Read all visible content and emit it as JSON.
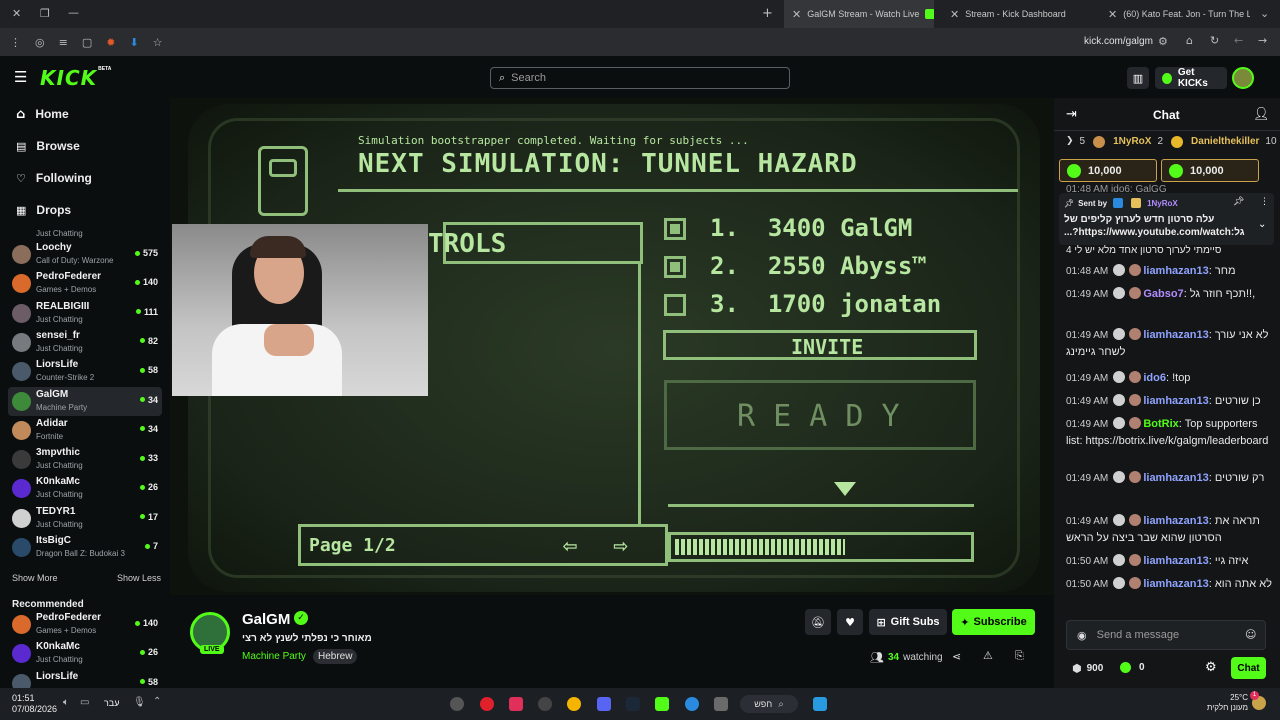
{
  "browser": {
    "tabs": [
      {
        "label": "GalGM Stream - Watch Live",
        "color": "#53fc18",
        "active": true
      },
      {
        "label": "Stream - Kick Dashboard",
        "color": "#53fc18",
        "active": false
      },
      {
        "label": "(60) Kato Feat. Jon - Turn The L",
        "color": "#ff0000",
        "active": false
      }
    ],
    "url": "kick.com/galgm"
  },
  "header": {
    "logo": "KICK",
    "logo_badge": "BETA",
    "search_placeholder": "Search",
    "get_kicks_label": "Get KICKs"
  },
  "sidebar": {
    "nav": [
      {
        "label": "Home",
        "icon": "home-icon",
        "glyph": "⌂"
      },
      {
        "label": "Browse",
        "icon": "browse-icon",
        "glyph": "▤"
      },
      {
        "label": "Following",
        "icon": "heart-icon",
        "glyph": "♡"
      },
      {
        "label": "Drops",
        "icon": "drops-icon",
        "glyph": "▦"
      }
    ],
    "partial_top_game": "Just Chatting",
    "channels": [
      {
        "name": "Loochy",
        "game": "Call of Duty: Warzone",
        "viewers": "575",
        "color": "#8a6d5a"
      },
      {
        "name": "PedroFederer",
        "game": "Games + Demos",
        "viewers": "140",
        "color": "#d96a2b"
      },
      {
        "name": "REALBIGIII",
        "game": "Just Chatting",
        "viewers": "111",
        "color": "#6b5c66"
      },
      {
        "name": "sensei_fr",
        "game": "Just Chatting",
        "viewers": "82",
        "color": "#777b80"
      },
      {
        "name": "LiorsLife",
        "game": "Counter-Strike 2",
        "viewers": "58",
        "color": "#4a5a6a"
      },
      {
        "name": "GalGM",
        "game": "Machine Party",
        "viewers": "34",
        "color": "#3d8a3a"
      },
      {
        "name": "Adidar",
        "game": "Fortnite",
        "viewers": "34",
        "color": "#c08a5a"
      },
      {
        "name": "3mpvthic",
        "game": "Just Chatting",
        "viewers": "33",
        "color": "#3a3a3a"
      },
      {
        "name": "K0nkaMc",
        "game": "Just Chatting",
        "viewers": "26",
        "color": "#5a2ad0"
      },
      {
        "name": "TEDYR1",
        "game": "Just Chatting",
        "viewers": "17",
        "color": "#d0d0d0"
      },
      {
        "name": "ItsBigC",
        "game": "Dragon Ball Z: Budokai 3",
        "viewers": "7",
        "color": "#2a4a6a"
      }
    ],
    "show_more": "Show More",
    "show_less": "Show Less",
    "recommended_title": "Recommended",
    "recommended": [
      {
        "name": "PedroFederer",
        "game": "Games + Demos",
        "viewers": "140",
        "color": "#d96a2b"
      },
      {
        "name": "K0nkaMc",
        "game": "Just Chatting",
        "viewers": "26",
        "color": "#5a2ad0"
      },
      {
        "name": "LiorsLife",
        "game": "",
        "viewers": "58",
        "color": "#4a5a6a"
      }
    ]
  },
  "video": {
    "line1": "Simulation bootstrapper completed. Waiting for subjects ...",
    "line2": "NEXT SIMULATION: TUNNEL HAZARD",
    "controls": "TROLS",
    "scores": [
      {
        "rank": "1.",
        "score": "3400",
        "name": "GalGM",
        "checked": true
      },
      {
        "rank": "2.",
        "score": "2550",
        "name": "Abyss™",
        "checked": true
      },
      {
        "rank": "3.",
        "score": "1700",
        "name": "jonatan",
        "checked": false
      }
    ],
    "invite": "INVITE",
    "ready": "R E A D Y",
    "page": "Page 1/2"
  },
  "stream": {
    "streamer": "GalGM",
    "live_badge": "LIVE",
    "title": "מאוחר כי נפלתי לשנץ לא רצי",
    "category": "Machine Party",
    "tag": "Hebrew",
    "gift_subs": "Gift Subs",
    "subscribe": "Subscribe",
    "viewers": "34",
    "watching_label": "watching"
  },
  "chat": {
    "title": "Chat",
    "gifters": [
      {
        "name": "",
        "count": "5"
      },
      {
        "name": "1NyRoX",
        "count": "2"
      },
      {
        "name": "Danielthekiller",
        "count": "10"
      }
    ],
    "kicks_pills": [
      "10,000",
      "10,000"
    ],
    "partial_line": "01:48 AM  ido6: GalGG",
    "pinned": {
      "sent_by": "Sent by",
      "sender": "1NyRoX",
      "text": "עלה סרטון חדש לערוץ קליפים של גל:https://www.youtube.com/watch?..."
    },
    "pinned_tail": "סיימתי לערוך סרטון אחד מלא יש לי 4",
    "messages": [
      {
        "time": "01:48 AM",
        "user": "liamhazan13",
        "color": "#8fa3ff",
        "text": "מחר"
      },
      {
        "time": "01:49 AM",
        "user": "Gabso7",
        "color": "#b18cff",
        "text": "תכף חוזר גל!!,"
      },
      {
        "time": "01:49 AM",
        "user": "liamhazan13",
        "color": "#8fa3ff",
        "text": "לא אני עורך לשחר גיימינג"
      },
      {
        "time": "01:49 AM",
        "user": "ido6",
        "color": "#8fa3ff",
        "text": "!top"
      },
      {
        "time": "01:49 AM",
        "user": "liamhazan13",
        "color": "#8fa3ff",
        "text": "כן שורטים"
      },
      {
        "time": "01:49 AM",
        "user": "BotRix",
        "color": "#53fc18",
        "text": "Top supporters list: https://botrix.live/k/galgm/leaderboard"
      },
      {
        "time": "01:49 AM",
        "user": "liamhazan13",
        "color": "#8fa3ff",
        "text": "רק שורטים"
      },
      {
        "time": "01:49 AM",
        "user": "liamhazan13",
        "color": "#8fa3ff",
        "text": "תראה את הסרטון שהוא שבר ביצה על הראש"
      },
      {
        "time": "01:50 AM",
        "user": "liamhazan13",
        "color": "#8fa3ff",
        "text": "איזה גיי"
      },
      {
        "time": "01:50 AM",
        "user": "liamhazan13",
        "color": "#8fa3ff",
        "text": "לא אתה הוא"
      }
    ],
    "input_placeholder": "Send a message",
    "points": "900",
    "kicks": "0",
    "send_label": "Chat"
  },
  "taskbar": {
    "time": "01:51",
    "date": "07/08/2026",
    "lang": "עבר",
    "search": "חפש",
    "weather_temp": "25°C",
    "weather_desc": "מעונן חלקית",
    "notif": "1"
  }
}
